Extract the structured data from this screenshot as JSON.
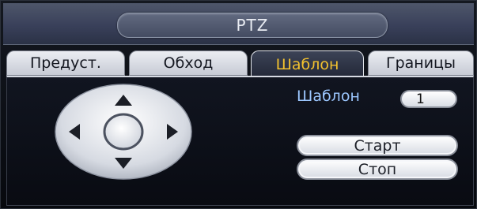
{
  "window": {
    "title": "PTZ"
  },
  "tabs": [
    {
      "label": "Предуст.",
      "active": false
    },
    {
      "label": "Обход",
      "active": false
    },
    {
      "label": "Шаблон",
      "active": true
    },
    {
      "label": "Границы",
      "active": false
    }
  ],
  "pattern": {
    "label": "Шаблон",
    "value": "1",
    "start_label": "Старт",
    "stop_label": "Стоп"
  },
  "icons": {
    "up": "arrow-up-icon",
    "down": "arrow-down-icon",
    "left": "arrow-left-icon",
    "right": "arrow-right-icon",
    "center": "center-button-icon"
  },
  "colors": {
    "active_tab_text": "#f2c12e",
    "label_text": "#9cc7ff",
    "background": "#0b0e16"
  }
}
